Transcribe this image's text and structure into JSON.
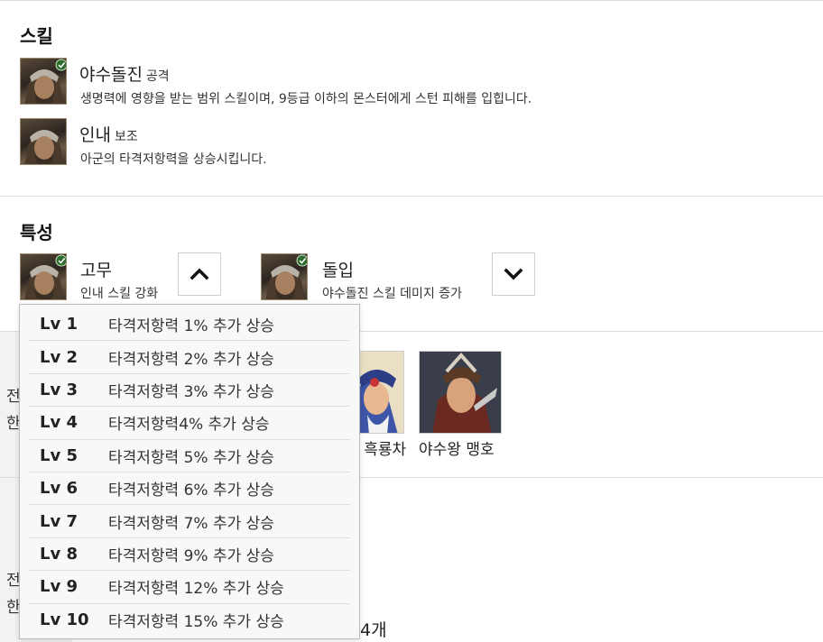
{
  "skills_section": {
    "title": "스킬",
    "items": [
      {
        "name": "야수돌진",
        "type": "공격",
        "description": "생명력에 영향을 받는 범위 스킬이며, 9등급 이하의 몬스터에게 스턴 피해를 입힙니다."
      },
      {
        "name": "인내",
        "type": "보조",
        "description": "아군의 타격저항력을 상승시킵니다."
      }
    ]
  },
  "traits_section": {
    "title": "특성",
    "items": [
      {
        "name": "고무",
        "description": "인내 스킬 강화",
        "toggle_icon": "chevron-up-icon"
      },
      {
        "name": "돌입",
        "description": "야수돌진 스킬 데미지 증가",
        "toggle_icon": "chevron-down-icon"
      }
    ]
  },
  "trait_levels": [
    {
      "level": "Lv 1",
      "effect": "타격저항력 1% 추가 상승"
    },
    {
      "level": "Lv 2",
      "effect": "타격저항력 2% 추가 상승"
    },
    {
      "level": "Lv 3",
      "effect": "타격저항력 3% 추가 상승"
    },
    {
      "level": "Lv 4",
      "effect": "타격저항력4% 추가 상승"
    },
    {
      "level": "Lv 5",
      "effect": "타격저항력 5% 추가 상승"
    },
    {
      "level": "Lv 6",
      "effect": "타격저항력 6% 추가 상승"
    },
    {
      "level": "Lv 7",
      "effect": "타격저항력 7% 추가 상승"
    },
    {
      "level": "Lv 8",
      "effect": "타격저항력 9% 추가 상승"
    },
    {
      "level": "Lv 9",
      "effect": "타격저항력 12% 추가 상승"
    },
    {
      "level": "Lv 10",
      "effect": "타격저항력 15% 추가 상승"
    }
  ],
  "partially_hidden": {
    "row1_label_top": "전",
    "row1_label_bottom": "한",
    "row2_label_top": "전",
    "row2_label_bottom": "한",
    "hero_partial_name": "! 흑룡차",
    "hero_name": "야수왕 맹호",
    "count_text": "4개"
  },
  "colors": {
    "divider": "#dcdcdc",
    "band": "#f2f2f2",
    "dropdown_bg": "#f8f8f8"
  }
}
